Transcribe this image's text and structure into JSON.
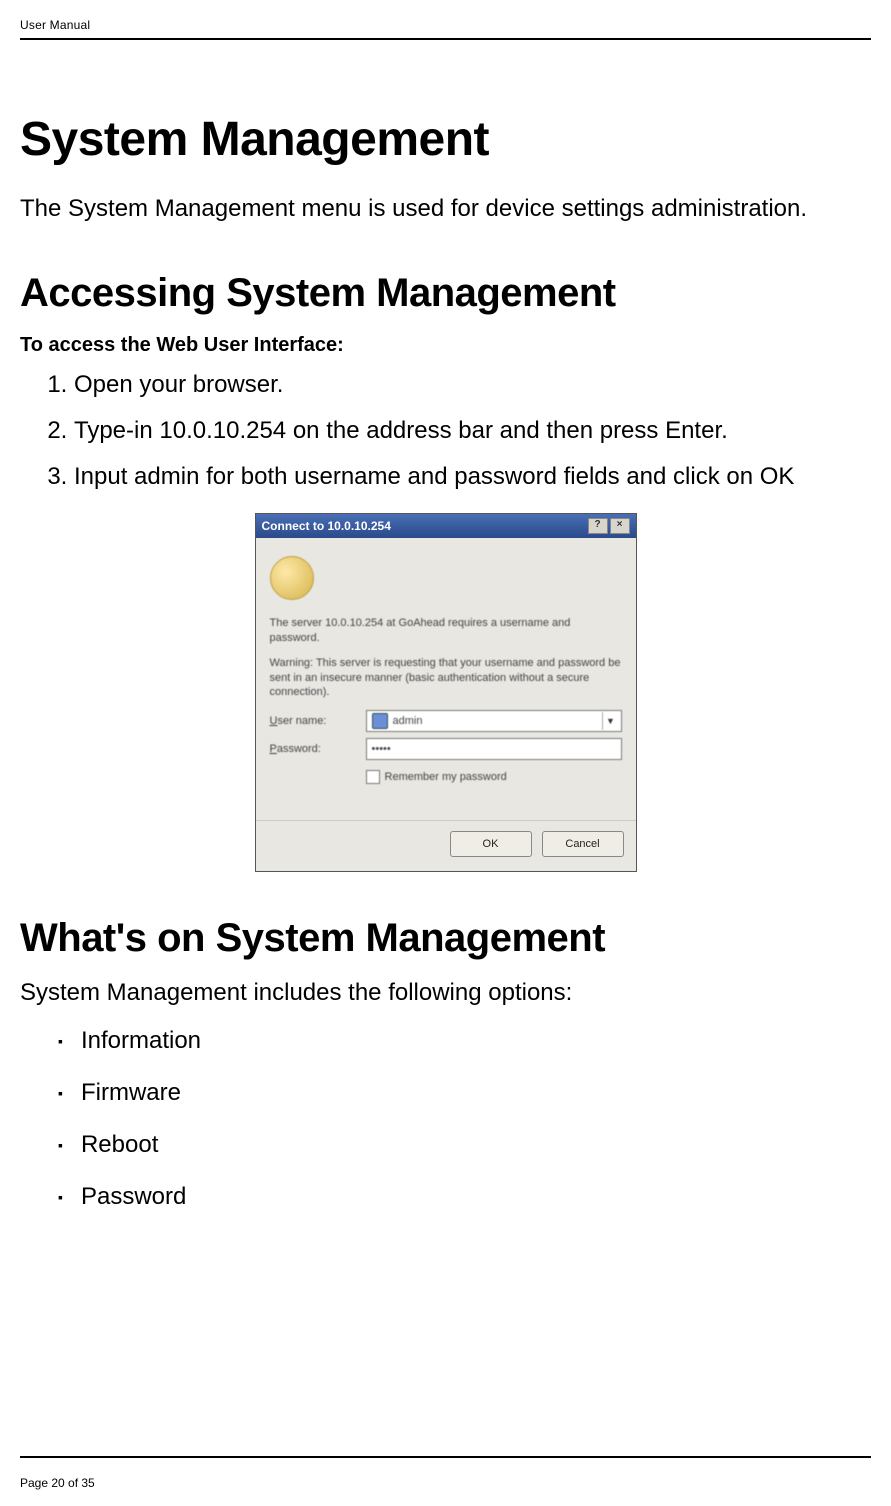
{
  "header": {
    "title": "User Manual"
  },
  "section1": {
    "heading": "System Management",
    "intro": "The System Management menu is used for device settings administration."
  },
  "section2": {
    "heading": "Accessing System Management",
    "subheading": "To access the Web User Interface:",
    "steps": [
      "Open your browser.",
      "Type-in 10.0.10.254 on the address bar and then press Enter.",
      "Input admin for both username and password fields and click on OK"
    ]
  },
  "dialog": {
    "title": "Connect to 10.0.10.254",
    "msg1": "The server 10.0.10.254 at GoAhead requires a username and password.",
    "msg2": "Warning: This server is requesting that your username and password be sent in an insecure manner (basic authentication without a secure connection).",
    "username_label": "User name:",
    "password_label": "Password:",
    "username_value": "admin",
    "password_value": "•••••",
    "remember_label": "Remember my password",
    "ok_label": "OK",
    "cancel_label": "Cancel"
  },
  "section3": {
    "heading": "What's on System Management",
    "intro": "System Management includes the following options:",
    "items": [
      "Information",
      "Firmware",
      "Reboot",
      "Password"
    ]
  },
  "footer": {
    "page_label": "Page 20 of 35"
  }
}
